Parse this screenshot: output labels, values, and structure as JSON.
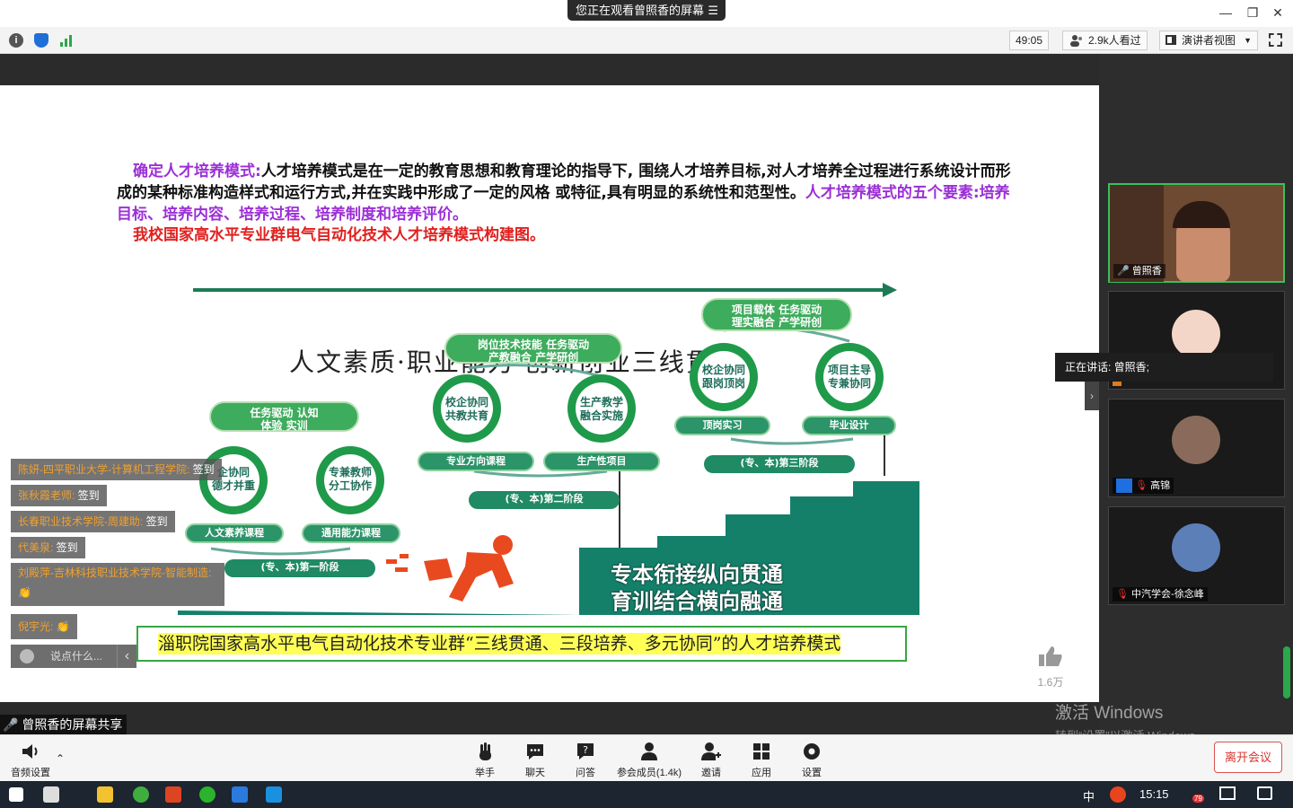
{
  "window": {
    "share_banner": "您正在观看曾照香的屏幕",
    "menu_glyph": "☰",
    "min": "—",
    "restore": "❐",
    "close": "✕"
  },
  "toolbar": {
    "timer": "49:05",
    "viewers": "2.9k人看过",
    "view_mode": "演讲者视图",
    "info_icon": "info-icon",
    "shield_icon": "shield-icon",
    "signal_icon": "signal-bars-icon"
  },
  "slide": {
    "para1_label": "确定人才培养模式:",
    "para1_text": "人才培养模式是在一定的教育思想和教育理论的指导下, 围绕人才培养目标,对人才培养全过程进行系统设计而形成的某种标准构造样式和运行方式,并在实践中形成了一定的风格 或特征,具有明显的系统性和范型性。",
    "para1_tail": "人才培养模式的五个要素:培养目标、培养内容、培养过程、培养制度和培养评价。",
    "para2": "我校国家高水平专业群电气自动化技术人才培养模式构建图。",
    "big_title": "人文素质·职业能力·创新创业三线贯穿",
    "stage1": {
      "header": [
        "任务驱动 认知",
        "体验 实训"
      ],
      "gear_left": [
        "企协同",
        "德才并重"
      ],
      "gear_right": [
        "专兼教师",
        "分工协作"
      ],
      "out_left": "人文素养课程",
      "out_right": "通用能力课程",
      "stage": "(专、本)第一阶段"
    },
    "stage2": {
      "header": [
        "岗位技术技能 任务驱动",
        "产教融合 产学研创"
      ],
      "gear_left": [
        "校企协同",
        "共教共育"
      ],
      "gear_right": [
        "生产教学",
        "融合实施"
      ],
      "out_left": "专业方向课程",
      "out_right": "生产性项目",
      "stage": "(专、本)第二阶段"
    },
    "stage3": {
      "header": [
        "项目载体 任务驱动",
        "理实融合 产学研创"
      ],
      "gear_left": [
        "校企协同",
        "跟岗顶岗"
      ],
      "gear_right": [
        "项目主导",
        "专兼协同"
      ],
      "out_left": "顶岗实习",
      "out_right": "毕业设计",
      "stage": "(专、本)第三阶段"
    },
    "stair_text": [
      "专本衔接纵向贯通",
      "育训结合横向融通"
    ],
    "caption": "淄职院国家高水平电气自动化技术专业群“三线贯通、三段培养、多元协同”的人才培养模式"
  },
  "chat": {
    "messages": [
      {
        "name": "陈妍-四平职业大学-计算机工程学院:",
        "text": " 签到"
      },
      {
        "name": "张秋霞老师:",
        "text": " 签到"
      },
      {
        "name": "长春职业技术学院-周建助:",
        "text": " 签到"
      },
      {
        "name": "代美泉:",
        "text": " 签到"
      },
      {
        "name": "刘殿萍-吉林科技职业技术学院-智能制造:",
        "text": "👏"
      },
      {
        "name": "倪宇光:",
        "text": " 👏"
      }
    ],
    "input_placeholder": "说点什么...",
    "collapse_glyph": "‹"
  },
  "like": {
    "count": "1.6万",
    "icon": "thumbs-up-icon"
  },
  "participants": [
    {
      "name": "曾照香",
      "mic": "mic-icon"
    },
    {
      "name": "",
      "mic": ""
    },
    {
      "name": "高锦",
      "mic": "mic-muted-icon"
    },
    {
      "name": "中汽学会-徐念峰",
      "mic": "mic-muted-icon"
    }
  ],
  "speaking": "正在讲话: 曾照香;",
  "share_tag": "曾照香的屏幕共享",
  "watermark": {
    "line1": "激活 Windows",
    "line2": "转到“设置”以激活 Windows。"
  },
  "bottombar": {
    "audio": "音频设置",
    "buttons": [
      "举手",
      "聊天",
      "问答",
      "参会成员(1.4k)",
      "邀请",
      "应用",
      "设置"
    ],
    "leave": "离开会议"
  },
  "taskbar": {
    "time": "15:15",
    "ime": "中",
    "badge": "79"
  }
}
